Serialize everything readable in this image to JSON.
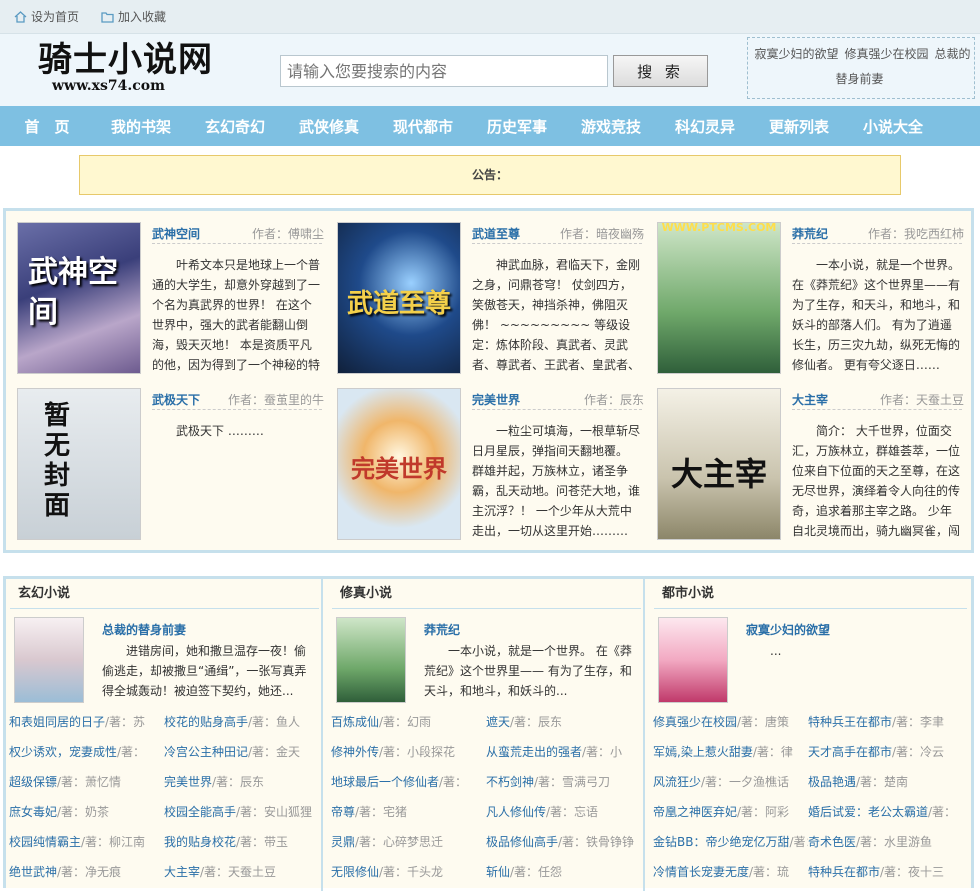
{
  "topbar": {
    "home": "设为首页",
    "fav": "加入收藏"
  },
  "logo": {
    "title": "骑士小说网",
    "url": "www.xs74.com"
  },
  "search": {
    "placeholder": "请输入您要搜索的内容",
    "button": "搜 索"
  },
  "hot": [
    "寂寞少妇的欲望",
    "修真强少在校园",
    "总裁的替身前妻"
  ],
  "nav": [
    "首　页",
    "我的书架",
    "玄幻奇幻",
    "武侠修真",
    "现代都市",
    "历史军事",
    "游戏竞技",
    "科幻灵异",
    "更新列表",
    "小说大全"
  ],
  "notice": "公告：",
  "featured": [
    {
      "title": "武神空间",
      "author": "作者：傅啸尘",
      "desc": "叶希文本只是地球上一个普通的大学生，却意外穿越到了一个名为真武界的世界！ 在这个世界中，强大的武者能翻山倒海，毁天灭地！ 本是资质平凡的他，因为得到了一个神秘的特",
      "cover_text": "武神空间"
    },
    {
      "title": "武道至尊",
      "author": "作者：暗夜幽殇",
      "desc": "神武血脉，君临天下，金刚之身，问鼎苍穹！ 仗剑四方，笑傲苍天，神挡杀神，佛阻灭佛！ ~~~~~~~~~ 等级设定：炼体阶段、真武者、灵武者、尊武者、王武者、皇武者、宗武",
      "cover_text": "武道至尊"
    },
    {
      "title": "莽荒纪",
      "author": "作者：我吃西红柿",
      "desc": "一本小说，就是一个世界。在《莽荒纪》这个世界里——有为了生存，和天斗，和地斗，和妖斗的部落人们。 有为了逍遥长生，历三灾九劫，纵死无悔的修仙者。 更有夸父逐日……",
      "cover_text": "WWW.PTCMS.COM"
    },
    {
      "title": "武极天下",
      "author": "作者：蚕茧里的牛",
      "desc": "武极天下 ………",
      "cover_text": "暂无封面"
    },
    {
      "title": "完美世界",
      "author": "作者：辰东",
      "desc": "一粒尘可填海，一根草斩尽日月星辰，弹指间天翻地覆。 群雄并起，万族林立，诸圣争霸，乱天动地。问苍茫大地，谁主沉浮？！ 一个少年从大荒中走出，一切从这里开始………",
      "cover_text": "完美世界"
    },
    {
      "title": "大主宰",
      "author": "作者：天蚕土豆",
      "desc": "简介： 大千世界，位面交汇，万族林立，群雄荟萃，一位位来自下位面的天之至尊，在这无尽世界，演绎着令人向往的传奇，追求着那主宰之路。 少年自北灵境而出，骑九幽冥雀，闯",
      "cover_text": "大主宰"
    }
  ],
  "categories": [
    {
      "heading": "玄幻小说",
      "top": {
        "title": "总裁的替身前妻",
        "desc": "进错房间，她和撒旦温存一夜！偷偷逃走，却被撒旦“通缉”，一张写真弄得全城轰动！被迫签下契约，她还..."
      },
      "books": [
        {
          "name": "和表姐同居的日子",
          "author": "/著：苏"
        },
        {
          "name": "校花的贴身高手",
          "author": "/著：鱼人"
        },
        {
          "name": "权少诱欢，宠妻成性",
          "author": "/著："
        },
        {
          "name": "冷宫公主种田记",
          "author": "/著：金天"
        },
        {
          "name": "超级保镖",
          "author": "/著：萧忆情"
        },
        {
          "name": "完美世界",
          "author": "/著：辰东"
        },
        {
          "name": "庶女毒妃",
          "author": "/著：奶茶"
        },
        {
          "name": "校园全能高手",
          "author": "/著：安山狐狸"
        },
        {
          "name": "校园纯情霸主",
          "author": "/著：柳江南"
        },
        {
          "name": "我的贴身校花",
          "author": "/著：带玉"
        },
        {
          "name": "绝世武神",
          "author": "/著：净无痕"
        },
        {
          "name": "大主宰",
          "author": "/著：天蚕土豆"
        }
      ]
    },
    {
      "heading": "修真小说",
      "top": {
        "title": "莽荒纪",
        "desc": "一本小说，就是一个世界。 在《莽荒纪》这个世界里—— 有为了生存，和天斗，和地斗，和妖斗的..."
      },
      "books": [
        {
          "name": "百炼成仙",
          "author": "/著：幻雨"
        },
        {
          "name": "遮天",
          "author": "/著：辰东"
        },
        {
          "name": "修神外传",
          "author": "/著：小段探花"
        },
        {
          "name": "从蛮荒走出的强者",
          "author": "/著：小"
        },
        {
          "name": "地球最后一个修仙者",
          "author": "/著："
        },
        {
          "name": "不朽剑神",
          "author": "/著：雪满弓刀"
        },
        {
          "name": "帝尊",
          "author": "/著：宅猪"
        },
        {
          "name": "凡人修仙传",
          "author": "/著：忘语"
        },
        {
          "name": "灵鼎",
          "author": "/著：心碎梦思迁"
        },
        {
          "name": "极品修仙高手",
          "author": "/著：铁骨铮铮"
        },
        {
          "name": "无限修仙",
          "author": "/著：千头龙"
        },
        {
          "name": "斩仙",
          "author": "/著：任怨"
        }
      ]
    },
    {
      "heading": "都市小说",
      "top": {
        "title": "寂寞少妇的欲望",
        "desc": "..."
      },
      "books": [
        {
          "name": "修真强少在校园",
          "author": "/著：唐策"
        },
        {
          "name": "特种兵王在都市",
          "author": "/著：李聿"
        },
        {
          "name": "军嫣,染上惹火甜妻",
          "author": "/著：律"
        },
        {
          "name": "天才高手在都市",
          "author": "/著：冷云"
        },
        {
          "name": "风流狂少",
          "author": "/著：一夕渔樵话"
        },
        {
          "name": "极品艳遇",
          "author": "/著：楚南"
        },
        {
          "name": "帝凰之神医弃妃",
          "author": "/著：阿彩"
        },
        {
          "name": "婚后试爱：老公太霸道",
          "author": "/著："
        },
        {
          "name": "金钻BB：帝少绝宠亿万甜",
          "author": "/著："
        },
        {
          "name": "奇术色医",
          "author": "/著：水里游鱼"
        },
        {
          "name": "冷情首长宠妻无度",
          "author": "/著：琉"
        },
        {
          "name": "特种兵在都市",
          "author": "/著：夜十三"
        }
      ]
    }
  ]
}
